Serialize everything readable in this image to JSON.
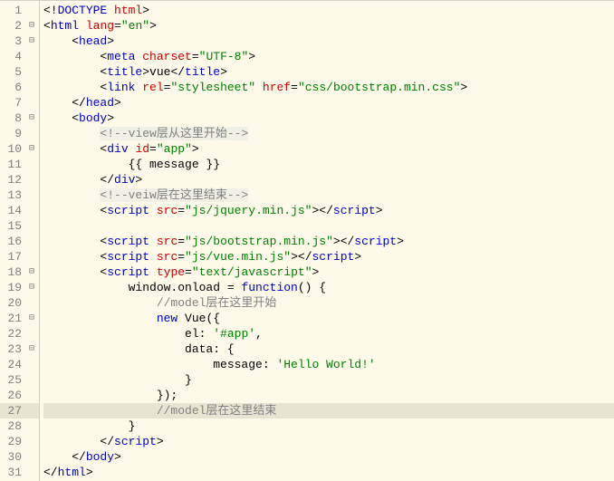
{
  "lines": [
    {
      "n": 1,
      "fold": "",
      "tokens": [
        {
          "c": "txt",
          "t": "<!"
        },
        {
          "c": "tag",
          "t": "DOCTYPE"
        },
        {
          "c": "txt",
          "t": " "
        },
        {
          "c": "attr",
          "t": "html"
        },
        {
          "c": "txt",
          "t": ">"
        }
      ]
    },
    {
      "n": 2,
      "fold": "⊟",
      "tokens": [
        {
          "c": "txt",
          "t": "<"
        },
        {
          "c": "tag",
          "t": "html"
        },
        {
          "c": "txt",
          "t": " "
        },
        {
          "c": "attr",
          "t": "lang"
        },
        {
          "c": "txt",
          "t": "="
        },
        {
          "c": "str",
          "t": "\"en\""
        },
        {
          "c": "txt",
          "t": ">"
        }
      ]
    },
    {
      "n": 3,
      "fold": "⊟",
      "tokens": [
        {
          "c": "txt",
          "t": "    <"
        },
        {
          "c": "tag",
          "t": "head"
        },
        {
          "c": "txt",
          "t": ">"
        }
      ]
    },
    {
      "n": 4,
      "fold": "",
      "tokens": [
        {
          "c": "txt",
          "t": "        <"
        },
        {
          "c": "tag",
          "t": "meta"
        },
        {
          "c": "txt",
          "t": " "
        },
        {
          "c": "attr",
          "t": "charset"
        },
        {
          "c": "txt",
          "t": "="
        },
        {
          "c": "str",
          "t": "\"UTF-8\""
        },
        {
          "c": "txt",
          "t": ">"
        }
      ]
    },
    {
      "n": 5,
      "fold": "",
      "tokens": [
        {
          "c": "txt",
          "t": "        <"
        },
        {
          "c": "tag",
          "t": "title"
        },
        {
          "c": "txt",
          "t": ">vue</"
        },
        {
          "c": "tag",
          "t": "title"
        },
        {
          "c": "txt",
          "t": ">"
        }
      ]
    },
    {
      "n": 6,
      "fold": "",
      "tokens": [
        {
          "c": "txt",
          "t": "        <"
        },
        {
          "c": "tag",
          "t": "link"
        },
        {
          "c": "txt",
          "t": " "
        },
        {
          "c": "attr",
          "t": "rel"
        },
        {
          "c": "txt",
          "t": "="
        },
        {
          "c": "str",
          "t": "\"stylesheet\""
        },
        {
          "c": "txt",
          "t": " "
        },
        {
          "c": "attr",
          "t": "href"
        },
        {
          "c": "txt",
          "t": "="
        },
        {
          "c": "str",
          "t": "\"css/bootstrap.min.css\""
        },
        {
          "c": "txt",
          "t": ">"
        }
      ]
    },
    {
      "n": 7,
      "fold": "",
      "tokens": [
        {
          "c": "txt",
          "t": "    </"
        },
        {
          "c": "tag",
          "t": "head"
        },
        {
          "c": "txt",
          "t": ">"
        }
      ]
    },
    {
      "n": 8,
      "fold": "⊟",
      "tokens": [
        {
          "c": "txt",
          "t": "    <"
        },
        {
          "c": "tag",
          "t": "body"
        },
        {
          "c": "txt",
          "t": ">"
        }
      ]
    },
    {
      "n": 9,
      "fold": "",
      "tokens": [
        {
          "c": "txt",
          "t": "        "
        },
        {
          "c": "txt-gray gray-bg",
          "t": "<!--view层从这里开始-->"
        }
      ]
    },
    {
      "n": 10,
      "fold": "⊟",
      "tokens": [
        {
          "c": "txt",
          "t": "        <"
        },
        {
          "c": "tag",
          "t": "div"
        },
        {
          "c": "txt",
          "t": " "
        },
        {
          "c": "attr",
          "t": "id"
        },
        {
          "c": "txt",
          "t": "="
        },
        {
          "c": "str",
          "t": "\"app\""
        },
        {
          "c": "txt",
          "t": ">"
        }
      ]
    },
    {
      "n": 11,
      "fold": "",
      "tokens": [
        {
          "c": "txt",
          "t": "            {{ message }}"
        }
      ]
    },
    {
      "n": 12,
      "fold": "",
      "tokens": [
        {
          "c": "txt",
          "t": "        </"
        },
        {
          "c": "tag",
          "t": "div"
        },
        {
          "c": "txt",
          "t": ">"
        }
      ]
    },
    {
      "n": 13,
      "fold": "",
      "tokens": [
        {
          "c": "txt",
          "t": "        "
        },
        {
          "c": "txt-gray gray-bg",
          "t": "<!--veiw层在这里结束-->"
        }
      ]
    },
    {
      "n": 14,
      "fold": "",
      "tokens": [
        {
          "c": "txt",
          "t": "        <"
        },
        {
          "c": "tag",
          "t": "script"
        },
        {
          "c": "txt",
          "t": " "
        },
        {
          "c": "attr",
          "t": "src"
        },
        {
          "c": "txt",
          "t": "="
        },
        {
          "c": "str",
          "t": "\"js/jquery.min.js\""
        },
        {
          "c": "txt",
          "t": "></"
        },
        {
          "c": "tag",
          "t": "script"
        },
        {
          "c": "txt",
          "t": ">"
        }
      ]
    },
    {
      "n": 15,
      "fold": "",
      "tokens": []
    },
    {
      "n": 16,
      "fold": "",
      "tokens": [
        {
          "c": "txt",
          "t": "        <"
        },
        {
          "c": "tag",
          "t": "script"
        },
        {
          "c": "txt",
          "t": " "
        },
        {
          "c": "attr",
          "t": "src"
        },
        {
          "c": "txt",
          "t": "="
        },
        {
          "c": "str",
          "t": "\"js/bootstrap.min.js\""
        },
        {
          "c": "txt",
          "t": "></"
        },
        {
          "c": "tag",
          "t": "script"
        },
        {
          "c": "txt",
          "t": ">"
        }
      ]
    },
    {
      "n": 17,
      "fold": "",
      "tokens": [
        {
          "c": "txt",
          "t": "        <"
        },
        {
          "c": "tag",
          "t": "script"
        },
        {
          "c": "txt",
          "t": " "
        },
        {
          "c": "attr",
          "t": "src"
        },
        {
          "c": "txt",
          "t": "="
        },
        {
          "c": "str",
          "t": "\"js/vue.min.js\""
        },
        {
          "c": "txt",
          "t": "></"
        },
        {
          "c": "tag",
          "t": "script"
        },
        {
          "c": "txt",
          "t": ">"
        }
      ]
    },
    {
      "n": 18,
      "fold": "⊟",
      "tokens": [
        {
          "c": "txt",
          "t": "        <"
        },
        {
          "c": "tag",
          "t": "script"
        },
        {
          "c": "txt",
          "t": " "
        },
        {
          "c": "attr",
          "t": "type"
        },
        {
          "c": "txt",
          "t": "="
        },
        {
          "c": "str",
          "t": "\"text/javascript\""
        },
        {
          "c": "txt",
          "t": ">"
        }
      ]
    },
    {
      "n": 19,
      "fold": "⊟",
      "tokens": [
        {
          "c": "txt",
          "t": "            window.onload = "
        },
        {
          "c": "tag",
          "t": "function"
        },
        {
          "c": "txt",
          "t": "() {"
        }
      ]
    },
    {
      "n": 20,
      "fold": "",
      "tokens": [
        {
          "c": "txt",
          "t": "                "
        },
        {
          "c": "txt-gray",
          "t": "//model层在这里开始"
        }
      ]
    },
    {
      "n": 21,
      "fold": "⊟",
      "tokens": [
        {
          "c": "txt",
          "t": "                "
        },
        {
          "c": "tag",
          "t": "new"
        },
        {
          "c": "txt",
          "t": " Vue({"
        }
      ]
    },
    {
      "n": 22,
      "fold": "",
      "tokens": [
        {
          "c": "txt",
          "t": "                    el: "
        },
        {
          "c": "str",
          "t": "'#app'"
        },
        {
          "c": "txt",
          "t": ","
        }
      ]
    },
    {
      "n": 23,
      "fold": "⊟",
      "tokens": [
        {
          "c": "txt",
          "t": "                    data: {"
        }
      ]
    },
    {
      "n": 24,
      "fold": "",
      "tokens": [
        {
          "c": "txt",
          "t": "                        message: "
        },
        {
          "c": "str",
          "t": "'Hello World!'"
        }
      ]
    },
    {
      "n": 25,
      "fold": "",
      "tokens": [
        {
          "c": "txt",
          "t": "                    }"
        }
      ]
    },
    {
      "n": 26,
      "fold": "",
      "tokens": [
        {
          "c": "txt",
          "t": "                });"
        }
      ]
    },
    {
      "n": 27,
      "fold": "",
      "hl": true,
      "tokens": [
        {
          "c": "txt",
          "t": "                "
        },
        {
          "c": "txt-gray",
          "t": "//model层在这里结束"
        }
      ]
    },
    {
      "n": 28,
      "fold": "",
      "tokens": [
        {
          "c": "txt",
          "t": "            }"
        }
      ]
    },
    {
      "n": 29,
      "fold": "",
      "tokens": [
        {
          "c": "txt",
          "t": "        </"
        },
        {
          "c": "tag",
          "t": "script"
        },
        {
          "c": "txt",
          "t": ">"
        }
      ]
    },
    {
      "n": 30,
      "fold": "",
      "tokens": [
        {
          "c": "txt",
          "t": "    </"
        },
        {
          "c": "tag",
          "t": "body"
        },
        {
          "c": "txt",
          "t": ">"
        }
      ]
    },
    {
      "n": 31,
      "fold": "",
      "tokens": [
        {
          "c": "txt",
          "t": "</"
        },
        {
          "c": "tag",
          "t": "html"
        },
        {
          "c": "txt",
          "t": ">"
        }
      ]
    }
  ]
}
